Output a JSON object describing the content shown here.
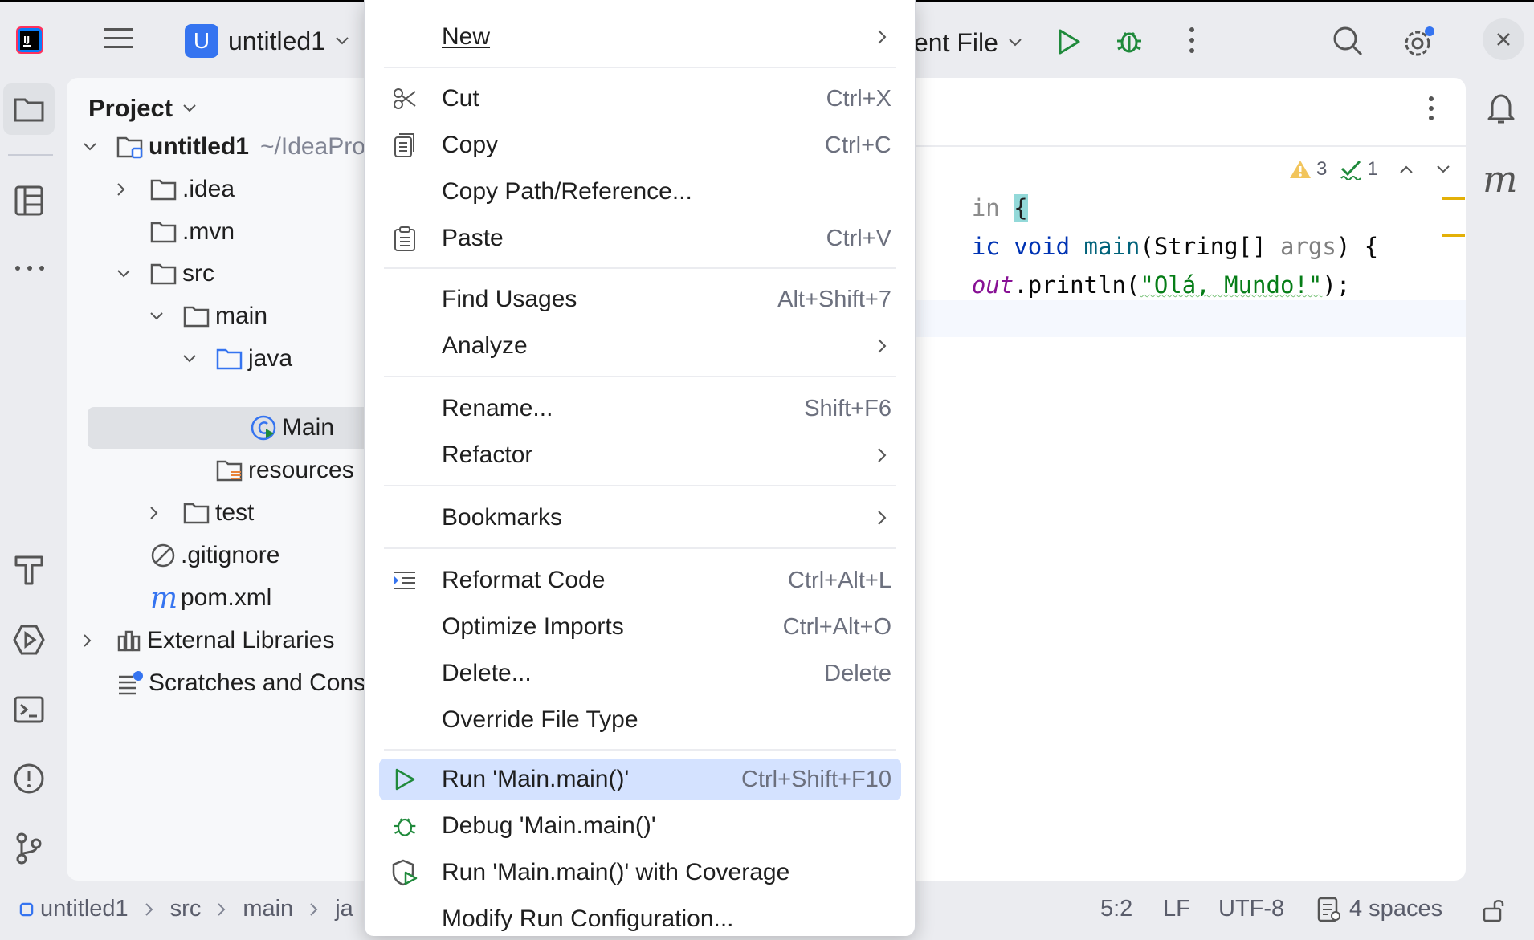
{
  "topbar": {
    "project_badge": "U",
    "project_name": "untitled1",
    "run_config": "ent File"
  },
  "project_panel": {
    "title": "Project",
    "tree": [
      {
        "label": "untitled1",
        "suffix": "~/IdeaPro"
      },
      {
        "label": ".idea"
      },
      {
        "label": ".mvn"
      },
      {
        "label": "src"
      },
      {
        "label": "main"
      },
      {
        "label": "java"
      },
      {
        "label": "Main"
      },
      {
        "label": "resources"
      },
      {
        "label": "test"
      },
      {
        "label": ".gitignore"
      },
      {
        "label": "pom.xml"
      },
      {
        "label": "External Libraries"
      },
      {
        "label": "Scratches and Cons"
      }
    ]
  },
  "editor": {
    "warnings": "3",
    "checks": "1",
    "line1_a": "in ",
    "line1_b": "{",
    "line2_a": "ic ",
    "line2_b": "void ",
    "line2_c": "main",
    "line2_d": "(String[] ",
    "line2_e": "args",
    "line2_f": ") {",
    "line3_a": "out",
    "line3_b": ".println(",
    "line3_c": "\"Olá, Mundo!\"",
    "line3_d": ");"
  },
  "menu": {
    "items": [
      {
        "label": "New",
        "shortcut": ""
      },
      {
        "label": "Cut",
        "shortcut": "Ctrl+X"
      },
      {
        "label": "Copy",
        "shortcut": "Ctrl+C"
      },
      {
        "label": "Copy Path/Reference...",
        "shortcut": ""
      },
      {
        "label": "Paste",
        "shortcut": "Ctrl+V"
      },
      {
        "label": "Find Usages",
        "shortcut": "Alt+Shift+7"
      },
      {
        "label": "Analyze",
        "shortcut": ""
      },
      {
        "label": "Rename...",
        "shortcut": "Shift+F6"
      },
      {
        "label": "Refactor",
        "shortcut": ""
      },
      {
        "label": "Bookmarks",
        "shortcut": ""
      },
      {
        "label": "Reformat Code",
        "shortcut": "Ctrl+Alt+L"
      },
      {
        "label": "Optimize Imports",
        "shortcut": "Ctrl+Alt+O"
      },
      {
        "label": "Delete...",
        "shortcut": "Delete"
      },
      {
        "label": "Override File Type",
        "shortcut": ""
      },
      {
        "label": "Run 'Main.main()'",
        "shortcut": "Ctrl+Shift+F10"
      },
      {
        "label": "Debug 'Main.main()'",
        "shortcut": ""
      },
      {
        "label": "Run 'Main.main()' with Coverage",
        "shortcut": ""
      },
      {
        "label": "Modify Run Configuration...",
        "shortcut": ""
      }
    ]
  },
  "statusbar": {
    "breadcrumb": [
      "untitled1",
      "src",
      "main",
      "ja"
    ],
    "position": "5:2",
    "line_sep": "LF",
    "encoding": "UTF-8",
    "indent": "4 spaces"
  },
  "colors": {
    "accent": "#3574f0",
    "run_green": "#208a3c",
    "menu_selection": "#d4e2ff"
  }
}
